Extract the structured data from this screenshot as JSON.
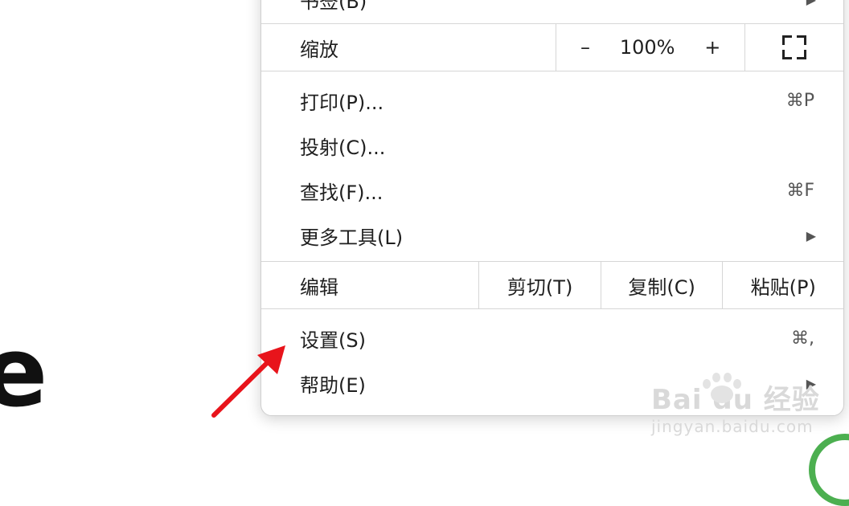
{
  "menu": {
    "bookmarks_partial": "书签(B)",
    "zoom": {
      "label": "缩放",
      "minus": "–",
      "value": "100%",
      "plus": "+"
    },
    "items_group1": [
      {
        "label": "打印(P)...",
        "shortcut": "⌘P"
      },
      {
        "label": "投射(C)...",
        "shortcut": ""
      },
      {
        "label": "查找(F)...",
        "shortcut": "⌘F"
      },
      {
        "label": "更多工具(L)",
        "shortcut": ""
      }
    ],
    "edit": {
      "label": "编辑",
      "cut": "剪切(T)",
      "copy": "复制(C)",
      "paste": "粘贴(P)"
    },
    "items_group2": [
      {
        "label": "设置(S)",
        "shortcut": "⌘,"
      },
      {
        "label": "帮助(E)",
        "shortcut": ""
      }
    ],
    "submenu_arrow": "▶"
  },
  "background": {
    "partial_glyph": "e"
  },
  "watermark": {
    "main": "Bai du 经验",
    "sub": "jingyan.baidu.com"
  },
  "annotation": {
    "arrow_color": "#e8141b"
  }
}
